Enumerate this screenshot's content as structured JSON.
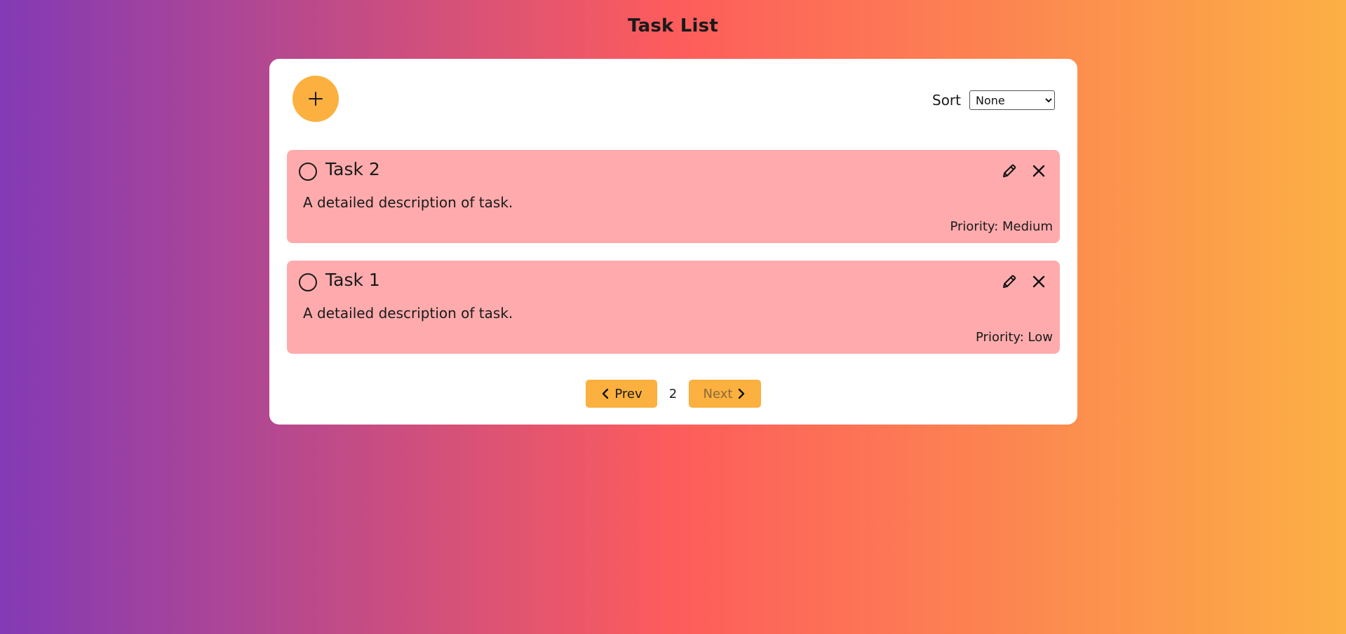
{
  "header": {
    "title": "Task List"
  },
  "toolbar": {
    "add_icon": "plus-icon",
    "sort_label": "Sort",
    "sort_value": "None",
    "sort_options": [
      "None"
    ]
  },
  "tasks": [
    {
      "title": "Task 2",
      "description": "A detailed description of task.",
      "priority": "Priority: Medium"
    },
    {
      "title": "Task 1",
      "description": "A detailed description of task.",
      "priority": "Priority: Low"
    }
  ],
  "pagination": {
    "prev_label": "Prev",
    "page": "2",
    "next_label": "Next"
  },
  "colors": {
    "gradient_start": "#833ab4",
    "gradient_mid": "#fd5c5c",
    "gradient_end": "#fcb045",
    "accent": "#fbb03f",
    "task_background": "#ffabad",
    "card_background": "#ffffff"
  }
}
